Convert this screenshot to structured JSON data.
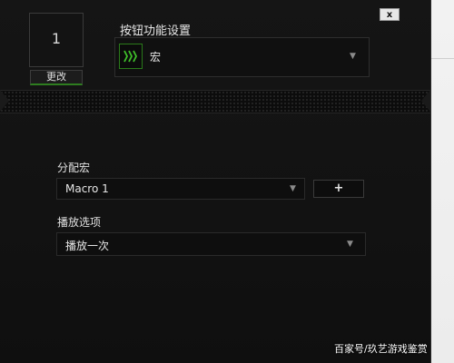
{
  "window": {
    "close_label": "x"
  },
  "button_panel": {
    "number": "1",
    "change_label": "更改"
  },
  "function": {
    "label": "按钮功能设置",
    "selected": "宏",
    "selected_icon": "macro-icon"
  },
  "assign_macro": {
    "label": "分配宏",
    "selected": "Macro 1",
    "add_label": "+"
  },
  "playback": {
    "label": "播放选项",
    "selected": "播放一次"
  },
  "watermark": {
    "text": "百家号/玖艺游戏鉴赏"
  },
  "colors": {
    "accent_green": "#2a7a1a",
    "background": "#131313",
    "text": "#e6e6e6"
  }
}
